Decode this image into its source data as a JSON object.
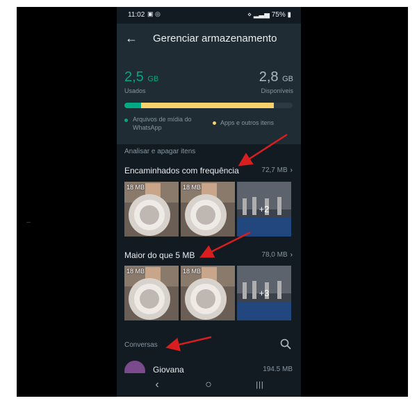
{
  "status_bar": {
    "time": "11:02",
    "icons": "▣ ◎",
    "right": "75%"
  },
  "header": {
    "title": "Gerenciar armazenamento"
  },
  "storage": {
    "used_value": "2,5",
    "used_unit": "GB",
    "used_label": "Usados",
    "available_value": "2,8",
    "available_unit": "GB",
    "available_label": "Disponíveis",
    "media_fraction": 0.1,
    "apps_fraction": 0.79,
    "legend_media": "Arquivos de mídia do WhatsApp",
    "legend_apps": "Apps e outros itens",
    "colors": {
      "media": "#00a884",
      "apps": "#f7d16e"
    }
  },
  "review": {
    "section_label": "Analisar e apagar itens",
    "forwarded": {
      "title": "Encaminhados com frequência",
      "size": "72,7 MB",
      "thumbs": [
        "18 MB",
        "18 MB"
      ],
      "more": "+2"
    },
    "large": {
      "title": "Maior do que 5 MB",
      "size": "78,0 MB",
      "thumbs": [
        "18 MB",
        "18 MB"
      ],
      "more": "+3"
    }
  },
  "conversations": {
    "label": "Conversas",
    "items": [
      {
        "name": "Giovana",
        "size": "194.5 MB"
      }
    ]
  },
  "nav": {
    "back": "‹",
    "home": "○",
    "recents": "|||"
  }
}
